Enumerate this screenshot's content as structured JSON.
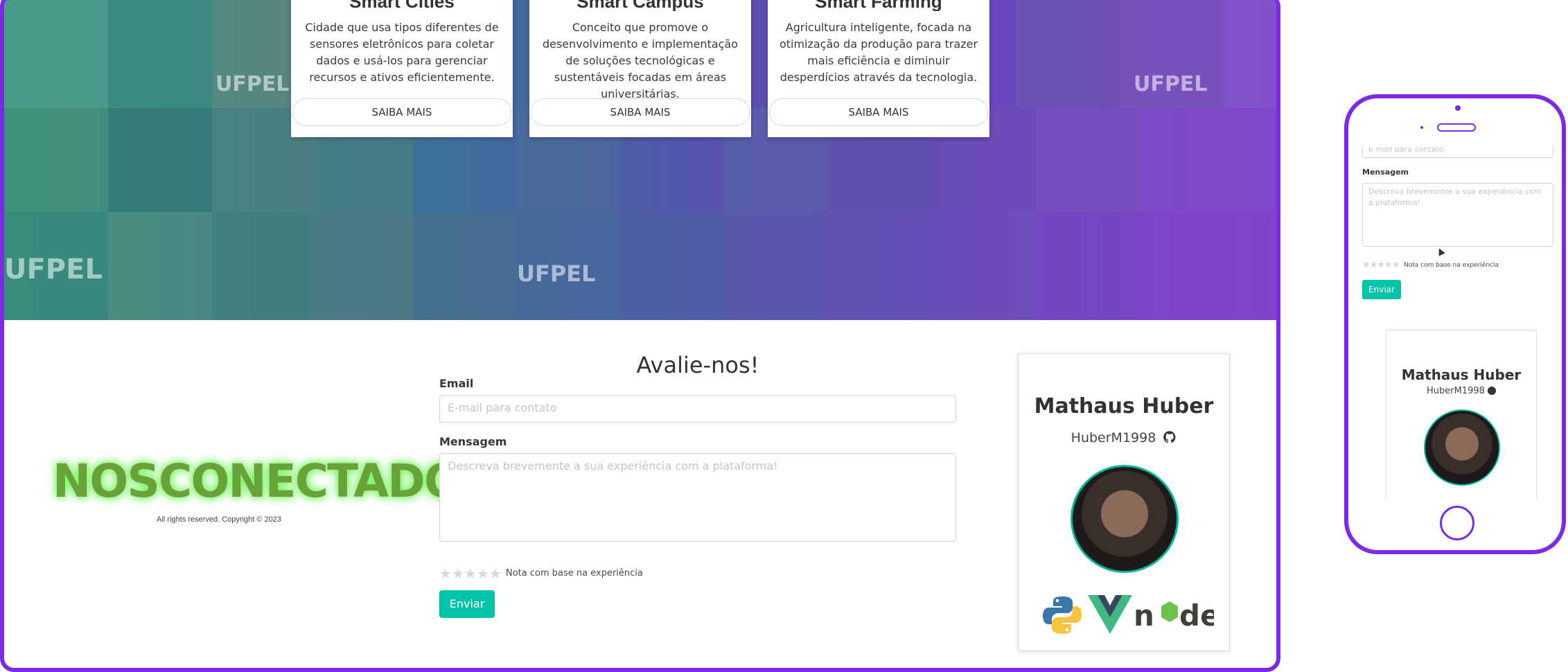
{
  "cards": [
    {
      "title": "Smart Cities",
      "text": "Cidade que usa tipos diferentes de sensores eletrônicos para coletar dados e usá-los para gerenciar recursos e ativos eficientemente.",
      "button": "SAIBA MAIS"
    },
    {
      "title": "Smart Campus",
      "text": "Conceito que promove o desenvolvimento e implementação de soluções tecnológicas e sustentáveis focadas em áreas universitárias.",
      "button": "SAIBA MAIS"
    },
    {
      "title": "Smart Farming",
      "text": "Agricultura inteligente, focada na otimização da produção para trazer mais eficiência e diminuir desperdícios através da tecnologia.",
      "button": "SAIBA MAIS"
    }
  ],
  "hero_texts": [
    "UFPEL",
    "UFPEL",
    "UFPEL",
    "UFPEL"
  ],
  "footer": {
    "brand": "NOSCONECTADOS",
    "copyright": "All rights reserved. Copyright © 2023"
  },
  "form": {
    "title": "Avalie-nos!",
    "email_label": "Email",
    "email_placeholder": "E-mail para contato",
    "message_label": "Mensagem",
    "message_placeholder": "Descreva brevemente a sua experiência com a plataforma!",
    "rating_note": "Nota com base na experiência",
    "submit": "Enviar"
  },
  "profile": {
    "name": "Mathaus Huber",
    "username": "HuberM1998"
  },
  "colors": {
    "frame": "#7c2ae8",
    "accent": "#00c4a7",
    "brand_green": "#6aa23a"
  },
  "icons": [
    "github-icon",
    "python-icon",
    "vue-icon",
    "node-icon",
    "star-icon",
    "cursor-icon"
  ]
}
